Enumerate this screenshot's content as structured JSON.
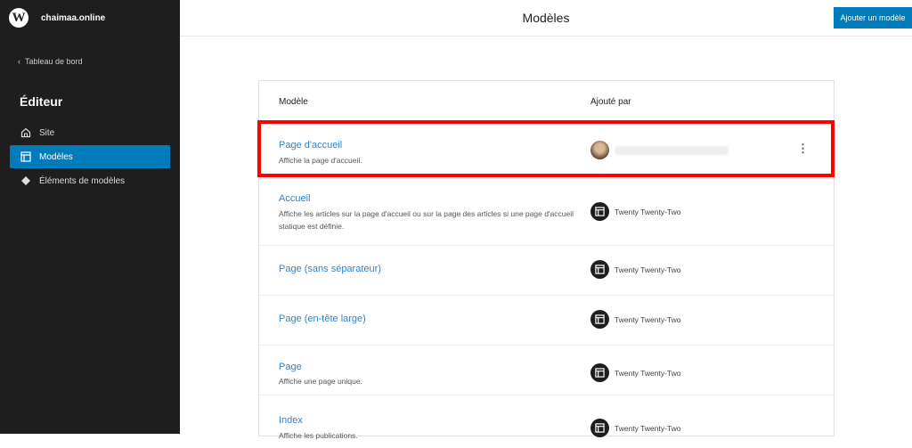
{
  "sidebar": {
    "site_name": "chaimaa.online",
    "back_label": "Tableau de bord",
    "section_title": "Éditeur",
    "items": [
      {
        "label": "Site",
        "icon": "home-icon"
      },
      {
        "label": "Modèles",
        "icon": "layout-icon",
        "active": true
      },
      {
        "label": "Éléments de modèles",
        "icon": "diamond-icon"
      }
    ]
  },
  "header": {
    "title": "Modèles",
    "add_button": "Ajouter un modèle"
  },
  "table": {
    "columns": [
      "Modèle",
      "Ajouté par"
    ],
    "rows": [
      {
        "title": "Page d'accueil",
        "desc": "Affiche la page d'accueil.",
        "author": ""
      },
      {
        "title": "Accueil",
        "desc": "Affiche les articles sur la page d'accueil ou sur la page des articles si une page d'accueil statique est définie.",
        "author": "Twenty Twenty-Two"
      },
      {
        "title": "Page (sans séparateur)",
        "desc": "",
        "author": "Twenty Twenty-Two"
      },
      {
        "title": "Page (en-tête large)",
        "desc": "",
        "author": "Twenty Twenty-Two"
      },
      {
        "title": "Page",
        "desc": "Affiche une page unique.",
        "author": "Twenty Twenty-Two"
      },
      {
        "title": "Index",
        "desc": "Affiche les publications.",
        "author": "Twenty Twenty-Two"
      }
    ]
  },
  "colors": {
    "accent": "#007cba",
    "highlight": "#ff0000",
    "sidebar": "#1e1e1e"
  }
}
